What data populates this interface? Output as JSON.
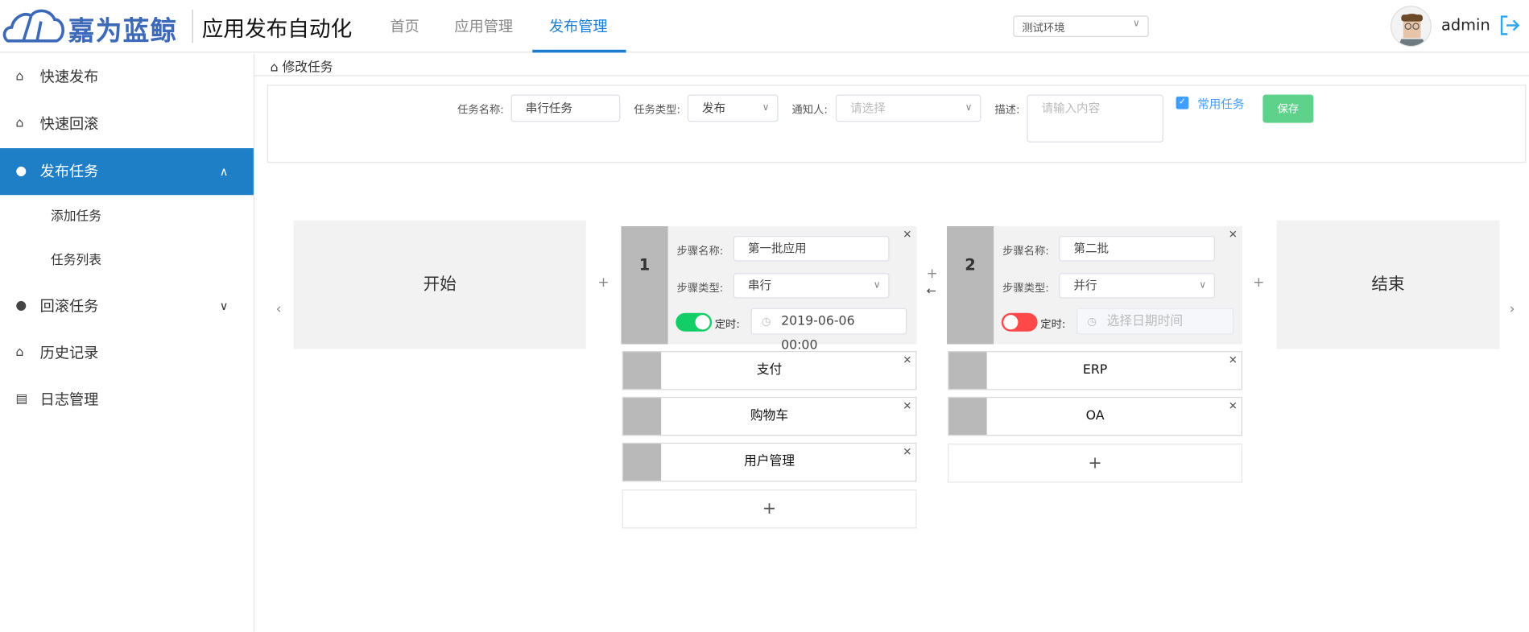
{
  "header": {
    "logo_text": "嘉为蓝鲸",
    "app_title": "应用发布自动化",
    "nav": [
      "首页",
      "应用管理",
      "发布管理"
    ],
    "active_nav": 2,
    "env": "测试环境",
    "user": "admin"
  },
  "sidebar": {
    "items": [
      {
        "label": "快速发布"
      },
      {
        "label": "快速回滚"
      },
      {
        "label": "发布任务"
      },
      {
        "label": "添加任务"
      },
      {
        "label": "任务列表"
      },
      {
        "label": "回滚任务"
      },
      {
        "label": "历史记录"
      },
      {
        "label": "日志管理"
      }
    ]
  },
  "breadcrumb": "修改任务",
  "form": {
    "name_label": "任务名称:",
    "name_value": "串行任务",
    "type_label": "任务类型:",
    "type_value": "发布",
    "notify_label": "通知人:",
    "notify_placeholder": "请选择",
    "desc_label": "描述:",
    "desc_placeholder": "请输入内容",
    "common_label": "常用任务",
    "common_checked": true,
    "save": "保存"
  },
  "flow": {
    "start": "开始",
    "end": "结束",
    "plus": "+",
    "steps": [
      {
        "num": "1",
        "name_label": "步骤名称:",
        "name": "第一批应用",
        "type_label": "步骤类型:",
        "type": "串行",
        "timer_label": "定时:",
        "timer_on": true,
        "time": "2019-06-06 00:00",
        "apps": [
          "支付",
          "购物车",
          "用户管理"
        ]
      },
      {
        "num": "2",
        "name_label": "步骤名称:",
        "name": "第二批",
        "type_label": "步骤类型:",
        "type": "并行",
        "timer_label": "定时:",
        "timer_on": false,
        "time_placeholder": "选择日期时间",
        "apps": [
          "ERP",
          "OA"
        ]
      }
    ]
  },
  "colors": {
    "primary": "#1e7cd0",
    "sidebar_active": "#1e7fc7",
    "save": "#5ed18b",
    "switch_on": "#13ce66",
    "switch_off": "#ff4949"
  }
}
